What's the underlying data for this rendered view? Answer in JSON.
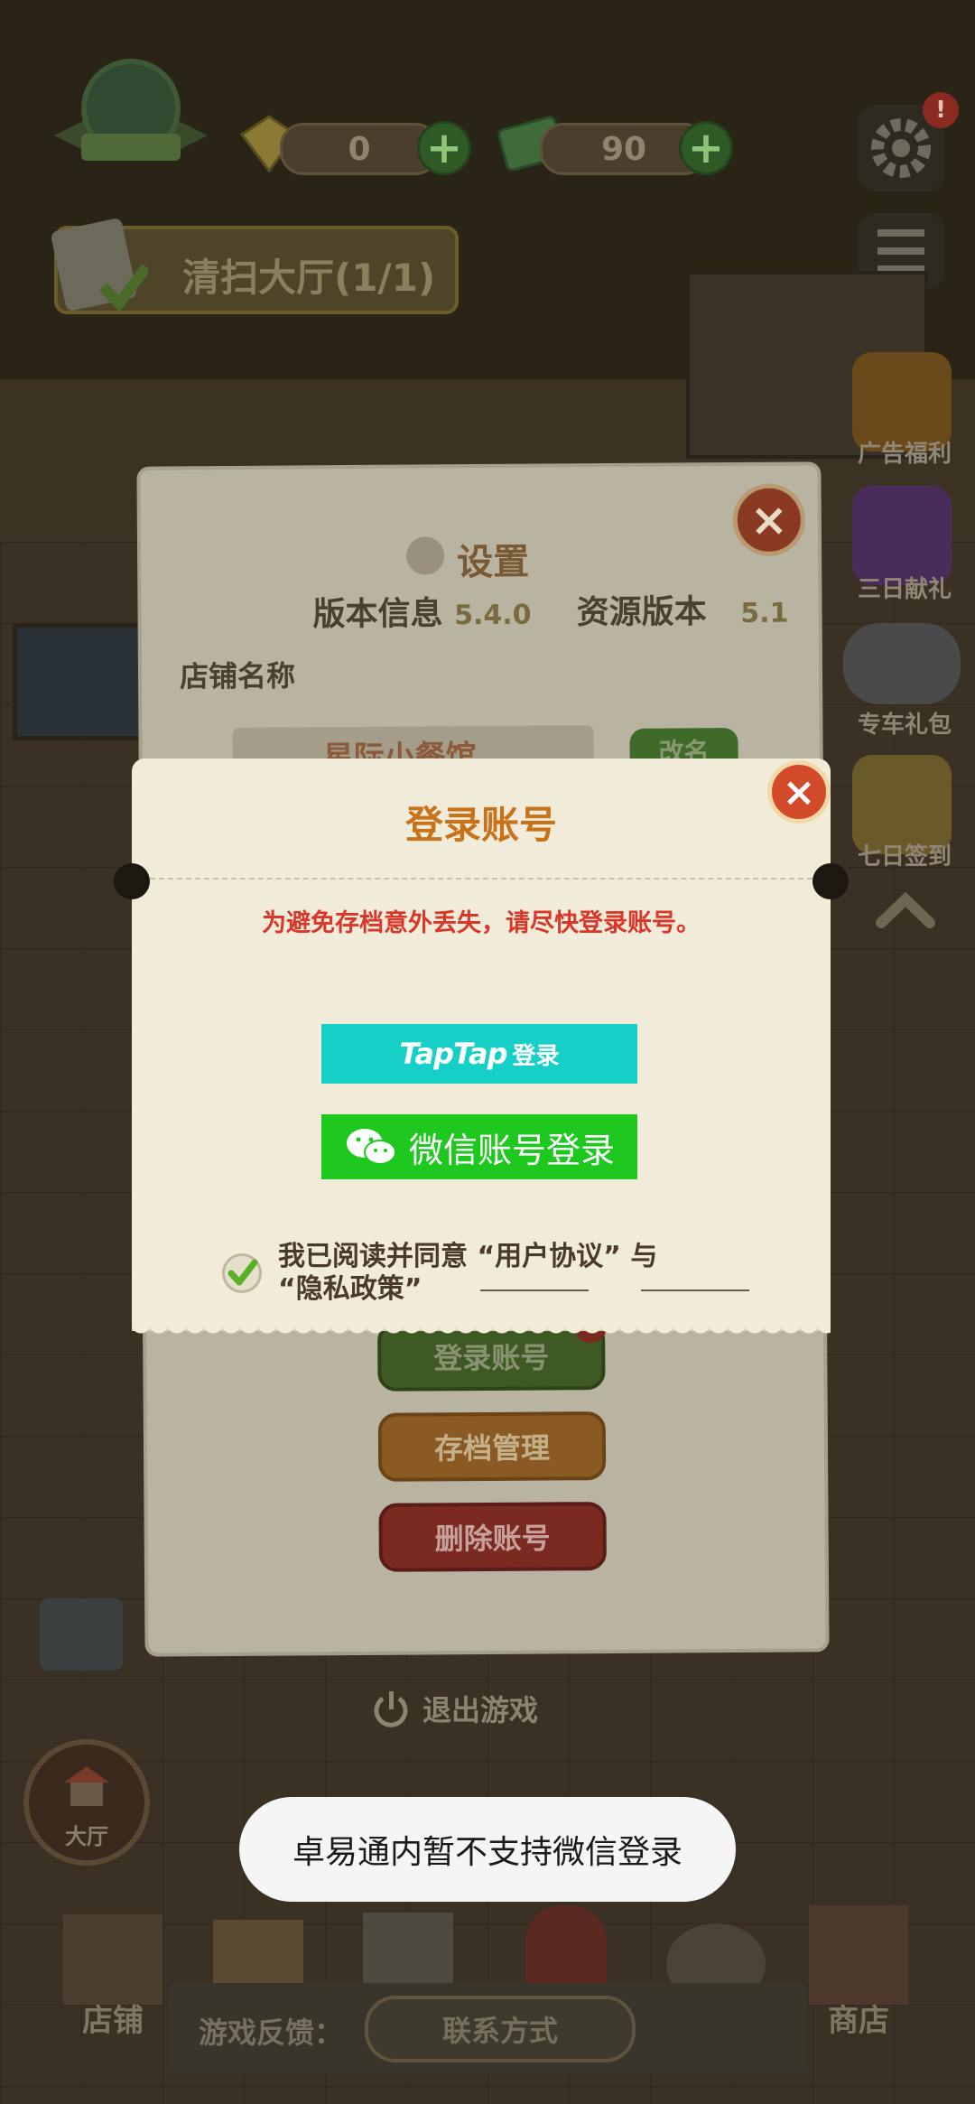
{
  "hud": {
    "gems": "0",
    "cash": "90",
    "task": "清扫大厅(1/1)"
  },
  "side_menu": [
    {
      "label": "广告福利"
    },
    {
      "label": "三日献礼"
    },
    {
      "label": "专车礼包"
    },
    {
      "label": "七日签到"
    }
  ],
  "settings": {
    "title": "设置",
    "version_label": "版本信息",
    "version_value": "5.4.0",
    "resource_label": "资源版本",
    "resource_value": "5.1",
    "shop_name_label": "店铺名称",
    "shop_name_value": "星际小餐馆",
    "rename_button": "改名",
    "login_button": "登录账号",
    "save_manage_button": "存档管理",
    "delete_account_button": "删除账号",
    "quit_label": "退出游戏"
  },
  "login_dialog": {
    "title": "登录账号",
    "warning": "为避免存档意外丢失，请尽快登录账号。",
    "taptap_brand": "TapTap",
    "taptap_suffix": "登录",
    "wechat_button": "微信账号登录",
    "agree_text_line1": "我已阅读并同意 “用户协议” 与",
    "agree_text_line2": "“隐私政策”",
    "agree_checked": true
  },
  "bottom_bar": {
    "hall": "大厅",
    "shop": "店铺",
    "store": "商店",
    "feedback_label": "游戏反馈：",
    "contact_button": "联系方式"
  },
  "toast": "卓易通内暂不支持微信登录",
  "colors": {
    "title_orange": "#c8731c",
    "warning_red": "#d8372a",
    "taptap": "#16cfc7",
    "wechat": "#1ec81e"
  }
}
